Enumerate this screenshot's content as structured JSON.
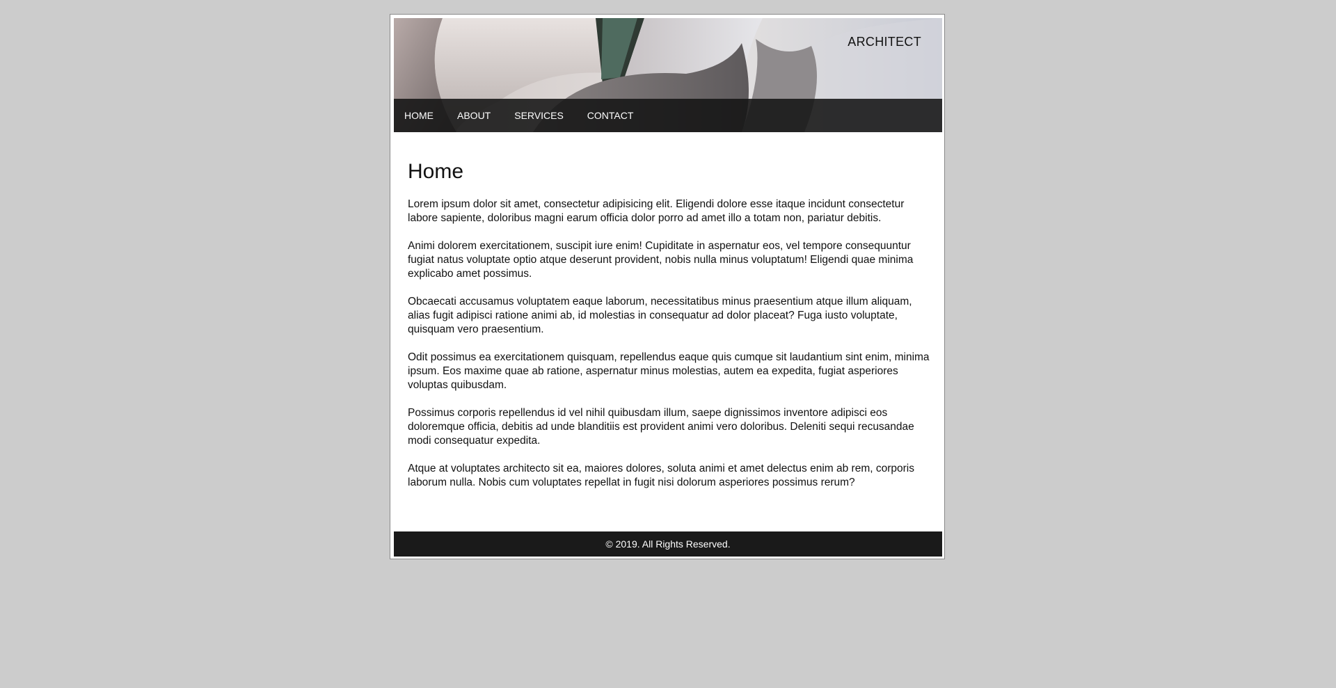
{
  "header": {
    "brand": "ARCHITECT"
  },
  "nav": {
    "items": [
      {
        "label": "HOME"
      },
      {
        "label": "ABOUT"
      },
      {
        "label": "SERVICES"
      },
      {
        "label": "CONTACT"
      }
    ]
  },
  "main": {
    "title": "Home",
    "paragraphs": [
      "Lorem ipsum dolor sit amet, consectetur adipisicing elit. Eligendi dolore esse itaque incidunt consectetur labore sapiente, doloribus magni earum officia dolor porro ad amet illo a totam non, pariatur debitis.",
      "Animi dolorem exercitationem, suscipit iure enim! Cupiditate in aspernatur eos, vel tempore consequuntur fugiat natus voluptate optio atque deserunt provident, nobis nulla minus voluptatum! Eligendi quae minima explicabo amet possimus.",
      "Obcaecati accusamus voluptatem eaque laborum, necessitatibus minus praesentium atque illum aliquam, alias fugit adipisci ratione animi ab, id molestias in consequatur ad dolor placeat? Fuga iusto voluptate, quisquam vero praesentium.",
      "Odit possimus ea exercitationem quisquam, repellendus eaque quis cumque sit laudantium sint enim, minima ipsum. Eos maxime quae ab ratione, aspernatur minus molestias, autem ea expedita, fugiat asperiores voluptas quibusdam.",
      "Possimus corporis repellendus id vel nihil quibusdam illum, saepe dignissimos inventore adipisci eos doloremque officia, debitis ad unde blanditiis est provident animi vero doloribus. Deleniti sequi recusandae modi consequatur expedita.",
      "Atque at voluptates architecto sit ea, maiores dolores, soluta animi et amet delectus enim ab rem, corporis laborum nulla. Nobis cum voluptates repellat in fugit nisi dolorum asperiores possimus rerum?"
    ]
  },
  "footer": {
    "copyright": "© 2019. All Rights Reserved."
  },
  "colors": {
    "page_background": "#cccccc",
    "nav_background": "#1e1e1e",
    "footer_background": "#1a1a1a",
    "text": "#111111"
  }
}
